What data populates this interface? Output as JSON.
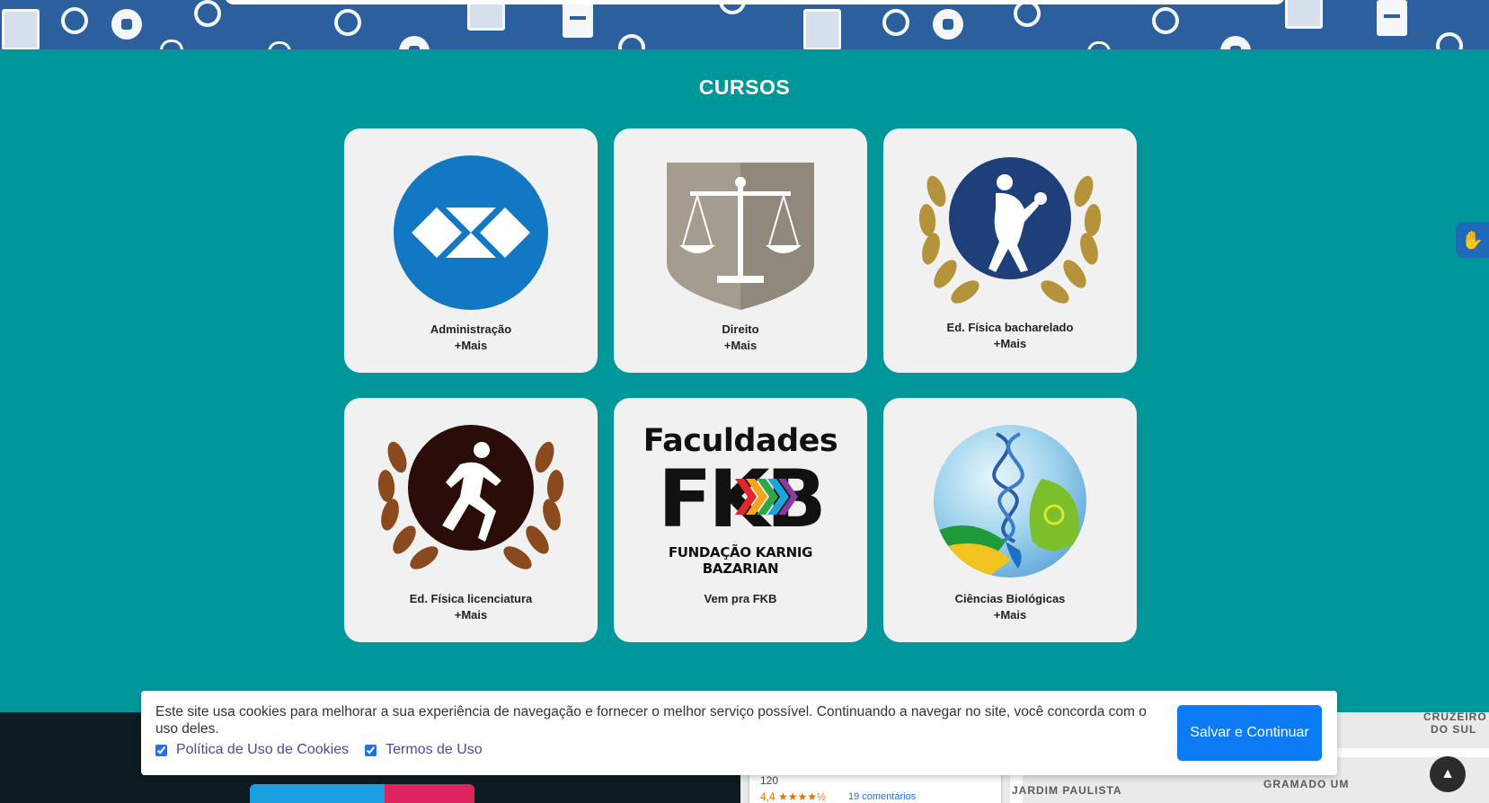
{
  "section": {
    "title": "CURSOS"
  },
  "courses": [
    {
      "name": "Administração",
      "more": "+Mais"
    },
    {
      "name": "Direito",
      "more": "+Mais"
    },
    {
      "name": "Ed. Física bacharelado",
      "more": "+Mais"
    },
    {
      "name": "Ed. Física licenciatura",
      "more": "+Mais"
    },
    {
      "name": "Vem pra FKB",
      "more": ""
    },
    {
      "name": "Ciências Biológicas",
      "more": "+Mais"
    }
  ],
  "fkb_logo": {
    "top": "Faculdades",
    "big": "FKB",
    "sub": "FUNDAÇÃO KARNIG BAZARIAN"
  },
  "cookie": {
    "message": "Este site usa cookies para melhorar a sua experiência de navegação e fornecer o melhor serviço possível. Continuando a navegar no site, você concorda com o uso deles.",
    "option_cookies": "Política de Uso de Cookies",
    "option_terms": "Termos de Uso",
    "button": "Salvar e Continuar"
  },
  "footer": {
    "map_count": "120",
    "map_rating": "4,4 ★★★★½",
    "map_reviews": "19 comentários",
    "map_labels": [
      "JARDIM PAULISTA",
      "GRAMADO UM",
      "CRUZEIRO",
      "DO SUL"
    ]
  },
  "colors": {
    "teal": "#00979b",
    "banner": "#2c5f9e",
    "card": "#f1f1f1",
    "button": "#0d7bf5"
  },
  "icons": [
    "book-icon",
    "soccer-ball-icon",
    "scale-of-justice-icon",
    "discus-thrower-icon",
    "runner-icon",
    "dna-leaf-icon",
    "sign-language-hand-icon",
    "arrow-up-icon"
  ]
}
